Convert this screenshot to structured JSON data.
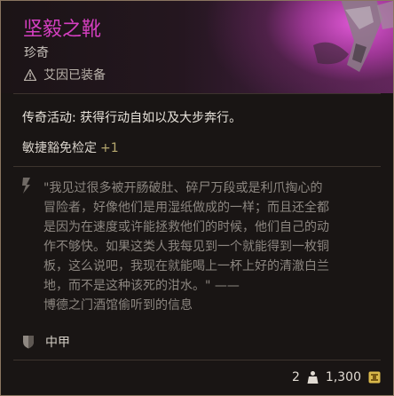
{
  "item": {
    "name": "坚毅之靴",
    "rarity": "珍奇",
    "equipped_by": "艾因已装备",
    "effect": "传奇活动: 获得行动自如以及大步奔行。",
    "bonus_label": "敏捷豁免检定",
    "bonus_value": "+1",
    "quote_lines": "\"我见过很多被开肠破肚、碎尸万段或是利爪掏心的\n冒险者，好像他们是用湿纸做成的一样；而且还全都\n是因为在速度或许能拯救他们的时候，他们自己的动\n作不够快。如果这类人我每见到一个就能得到一枚铜\n板，这么说吧，我现在就能喝上一杯上好的清澈白兰\n地，而不是这种该死的泔水。\" ——",
    "quote_source": "博德之门酒馆偷听到的信息",
    "armor_type": "中甲",
    "weight": "2",
    "value": "1,300"
  },
  "colors": {
    "name": "#d43fc0",
    "bonus_value": "#b6a86f",
    "background": "#191514"
  },
  "icons": {
    "equipped": "warning-triangle-icon",
    "quote": "lore-quote-icon",
    "armor": "shield-icon",
    "weight": "weight-icon",
    "value": "gold-coin-icon"
  }
}
